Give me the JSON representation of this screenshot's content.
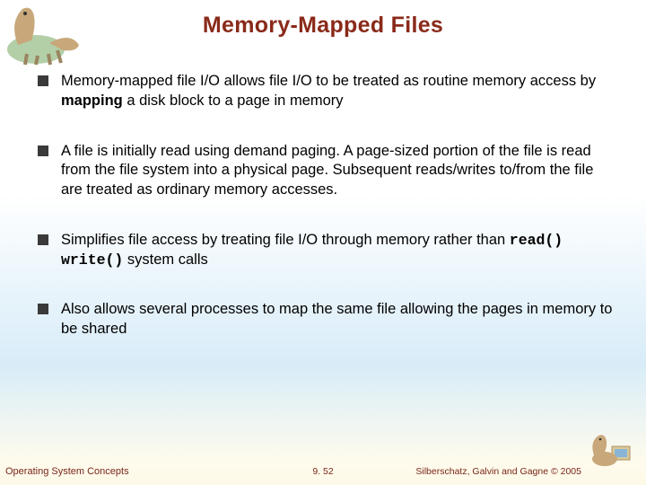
{
  "title": "Memory-Mapped Files",
  "bullets": [
    {
      "fragments": [
        {
          "t": "Memory-mapped",
          "cls": ""
        },
        {
          "t": " file I/O allows file I/O to be treated as routine memory access by ",
          "cls": ""
        },
        {
          "t": "mapping",
          "cls": "bold"
        },
        {
          "t": " a disk block to a page in memory",
          "cls": ""
        }
      ]
    },
    {
      "fragments": [
        {
          "t": "A file is initially read using demand paging. A page-sized portion of the file is read from the file system into a physical page. Subsequent reads/writes to/from the file are treated as ordinary memory accesses.",
          "cls": ""
        }
      ]
    },
    {
      "fragments": [
        {
          "t": "Simplifies file access by treating file I/O through memory rather than ",
          "cls": ""
        },
        {
          "t": "read() write()",
          "cls": "mono"
        },
        {
          "t": " system calls",
          "cls": ""
        }
      ]
    },
    {
      "fragments": [
        {
          "t": "Also allows several processes to map the same file allowing the pages in memory to be shared",
          "cls": ""
        }
      ]
    }
  ],
  "footer": {
    "left": "Operating System Concepts",
    "center": "9. 52",
    "right": "Silberschatz, Galvin and Gagne © 2005"
  },
  "colors": {
    "title": "#8a2a1a",
    "footer": "#7a2618"
  }
}
